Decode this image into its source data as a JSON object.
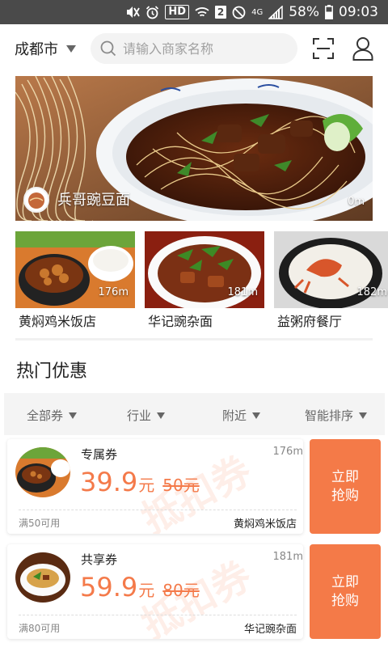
{
  "status_bar": {
    "hd": "HD",
    "sim": "2",
    "network": "4G",
    "battery": "58%",
    "time": "09:03"
  },
  "header": {
    "city": "成都市",
    "search_placeholder": "请输入商家名称"
  },
  "banner": {
    "shop_name": "兵哥豌豆面",
    "distance": "0m"
  },
  "nearby_shops": [
    {
      "name": "黄焖鸡米饭店",
      "distance": "176m"
    },
    {
      "name": "华记豌杂面",
      "distance": "181m"
    },
    {
      "name": "益粥府餐厅",
      "distance": "182m"
    }
  ],
  "section": {
    "title": "热门优惠"
  },
  "filters": [
    {
      "label": "全部券"
    },
    {
      "label": "行业"
    },
    {
      "label": "附近"
    },
    {
      "label": "智能排序"
    }
  ],
  "coupons": [
    {
      "type": "专属券",
      "distance": "176m",
      "price": "39.9",
      "price_unit": "元",
      "original": "50元",
      "rule": "满50可用",
      "shop": "黄焖鸡米饭店",
      "watermark": "抵扣券",
      "button_label": "立即抢购"
    },
    {
      "type": "共享券",
      "distance": "181m",
      "price": "59.9",
      "price_unit": "元",
      "original": "80元",
      "rule": "满80可用",
      "shop": "华记豌杂面",
      "watermark": "抵扣券",
      "button_label": "立即抢购"
    }
  ],
  "colors": {
    "accent": "#f47a48",
    "status_bar": "#4a4a4a"
  }
}
